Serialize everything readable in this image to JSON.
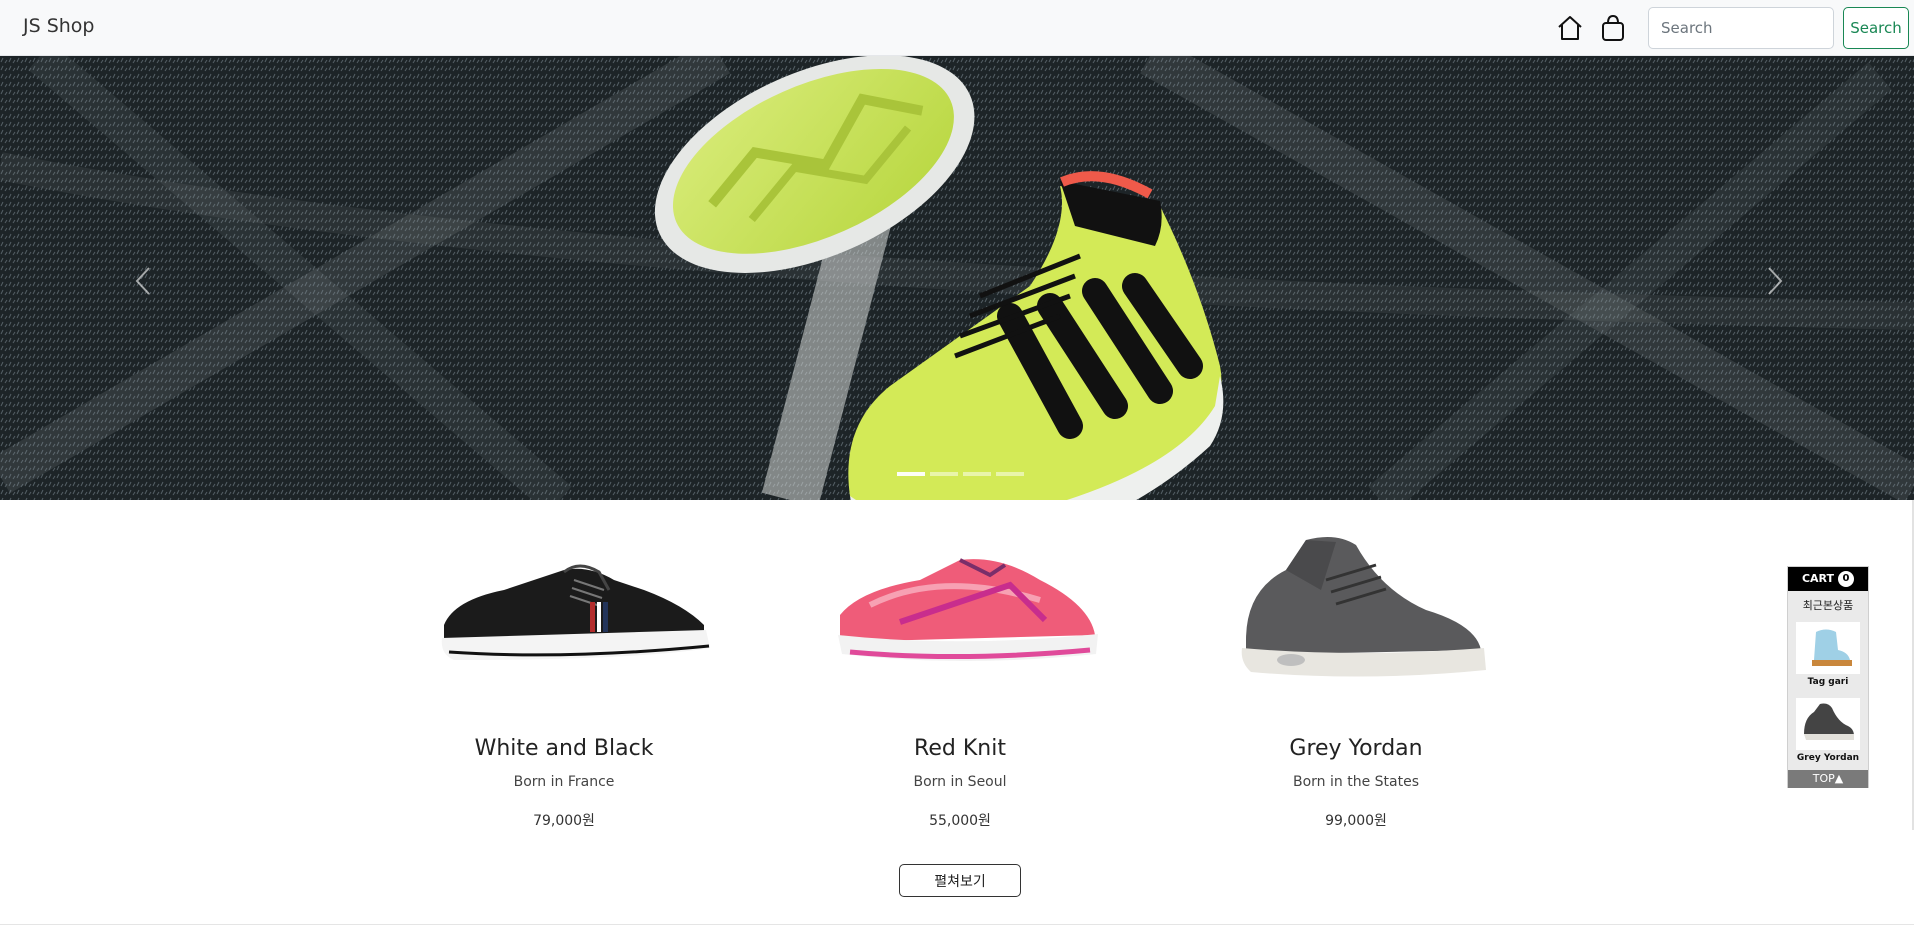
{
  "navbar": {
    "brand": "JS Shop",
    "home_icon": "home-icon",
    "bag_icon": "shopping-bag-icon",
    "search_placeholder": "Search",
    "search_button": "Search"
  },
  "hero": {
    "image": "soccer-shoes-on-turf-photo",
    "prev_icon": "chevron-left-icon",
    "next_icon": "chevron-right-icon",
    "slide_count": 4,
    "active_slide": 1
  },
  "products": [
    {
      "name": "White and Black",
      "origin": "Born in France",
      "price": "79,000원",
      "image": "black-sneaker"
    },
    {
      "name": "Red Knit",
      "origin": "Born in Seoul",
      "price": "55,000원",
      "image": "red-running-shoe"
    },
    {
      "name": "Grey Yordan",
      "origin": "Born in the States",
      "price": "99,000원",
      "image": "grey-high-top"
    }
  ],
  "more_button": "펼쳐보기",
  "recent": {
    "cart_label": "CART",
    "cart_count": "0",
    "title": "최근본상품",
    "items": [
      {
        "label": "Tag gari",
        "image": "tan-boot"
      },
      {
        "label": "Grey Yordan",
        "image": "grey-high-top"
      }
    ],
    "top_label": "TOP▲"
  },
  "colors": {
    "navbar_bg": "#f8f9fa",
    "search_button": "#198754",
    "shoe_green": "#cde84a",
    "accent_red": "#ef5a4a"
  }
}
